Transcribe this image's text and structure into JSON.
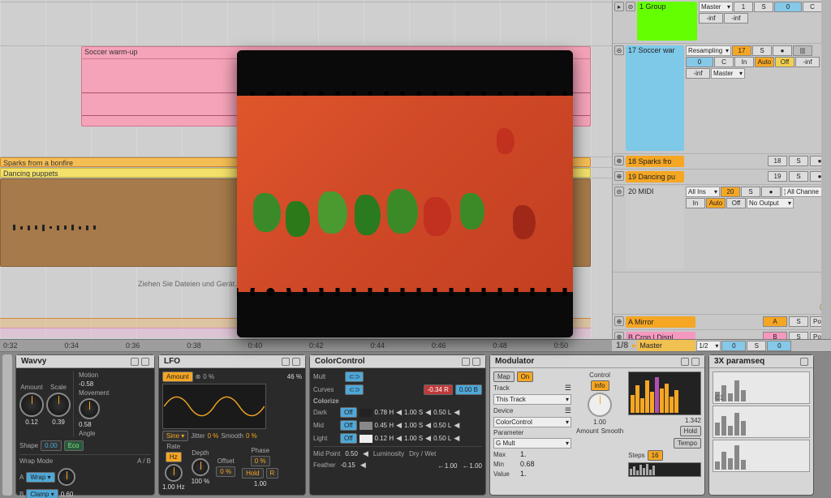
{
  "arrangement": {
    "clips": {
      "soccer": "Soccer warm-up",
      "sparks": "Sparks from a bonfire",
      "dancing": "Dancing puppets"
    },
    "drop_hint": "Ziehen Sie Dateien und Gerät…"
  },
  "ruler": [
    "0:32",
    "0:34",
    "0:36",
    "0:38",
    "0:40",
    "0:42",
    "0:44",
    "0:46",
    "0:48",
    "0:50"
  ],
  "mixer": {
    "group": {
      "label": "1 Group",
      "route": "Master",
      "num": "1",
      "s": "S",
      "send": "0",
      "c": "C",
      "inf1": "-inf",
      "inf2": "-inf"
    },
    "soccer": {
      "label": "17 Soccer war",
      "route": "Resampling",
      "num": "17",
      "s": "S",
      "rec": "●",
      "send": "0",
      "c": "C",
      "in": "In",
      "auto": "Auto",
      "off": "Off",
      "inf1": "-inf",
      "inf2": "-inf",
      "master": "Master"
    },
    "sparks": {
      "label": "18 Sparks fro",
      "num": "18",
      "s": "S",
      "rec": "●"
    },
    "dancing": {
      "label": "19 Dancing pu",
      "num": "19",
      "s": "S",
      "rec": "●"
    },
    "midi": {
      "label": "20 MIDI",
      "in_route": "All Ins",
      "ch": "¦ All Channe",
      "num": "20",
      "s": "S",
      "rec": "●",
      "in": "In",
      "auto": "Auto",
      "off": "Off",
      "out": "No Output"
    },
    "a": {
      "label": "A Mirror",
      "num": "A",
      "s": "S",
      "post": "Post"
    },
    "b": {
      "label": "B Crop | Displ",
      "num": "B",
      "s": "S",
      "post": "Post"
    },
    "master": {
      "frac": "1/8",
      "label": "Master",
      "div": "1/2",
      "send": "0",
      "s": "S",
      "val": "0"
    }
  },
  "devices": {
    "wavvy": {
      "title": "Wavvy",
      "amount": {
        "label": "Amount",
        "value": "0.12"
      },
      "scale": {
        "label": "Scale",
        "value": "0.39"
      },
      "motion": {
        "label": "Motion",
        "value": "-0.58"
      },
      "movement": {
        "label": "Movement",
        "angle_label": "Angle",
        "value": "0.58"
      },
      "shape": {
        "label": "Shape",
        "value": "0.00",
        "eco": "Eco"
      },
      "wrap": {
        "header": "Wrap Mode",
        "ab": "A / B",
        "a": {
          "lab": "A",
          "mode": "Wrap"
        },
        "b": {
          "lab": "B",
          "mode": "Clamp"
        },
        "val": "0.60"
      }
    },
    "lfo": {
      "title": "LFO",
      "amount": {
        "label": "Amount",
        "sym": "⊗",
        "pct0": "0 %",
        "pct": "46 %"
      },
      "wave": "Sine",
      "jitter": {
        "label": "Jitter",
        "val": "0 %"
      },
      "smooth": {
        "label": "Smooth",
        "val": "0 %"
      },
      "rate": {
        "label": "Rate",
        "hz_btn": "Hz",
        "value": "1.00 Hz"
      },
      "depth": {
        "label": "Depth",
        "value": "100 %"
      },
      "offset": {
        "label": "Offset",
        "value": "0 %"
      },
      "phase": {
        "label": "Phase",
        "hold": "Hold",
        "r": "R",
        "value": "1.00"
      }
    },
    "colorcontrol": {
      "title": "ColorControl",
      "mult": "Mult",
      "curves": "Curves",
      "curves_r": "-0.34 R",
      "curves_b": "0.00 B",
      "colorize": "Colorize",
      "dark": {
        "label": "Dark",
        "off": "Off",
        "h": "0.78 H",
        "s": "1.00 S",
        "l": "0.50 L"
      },
      "mid": {
        "label": "Mid",
        "off": "Off",
        "h": "0.45 H",
        "s": "1.00 S",
        "l": "0.50 L"
      },
      "light": {
        "label": "Light",
        "off": "Off",
        "h": "0.12 H",
        "s": "1.00 S",
        "l": "0.50 L"
      },
      "midpoint": {
        "label": "Mid Point",
        "value": "0.50"
      },
      "feather": {
        "label": "Feather",
        "value": "-0.15"
      },
      "lum": {
        "label": "Luminosity",
        "value": "1.00"
      },
      "drywet": {
        "label": "Dry / Wet",
        "value": "1.00"
      }
    },
    "modulator": {
      "title": "Modulator",
      "map": "Map",
      "on": "On",
      "track": "Track",
      "track_sel": "This Track",
      "device": "Device",
      "device_sel": "ColorControl",
      "param": "Parameter",
      "param_sel": "G Mult",
      "max": {
        "label": "Max",
        "value": "1."
      },
      "min": {
        "label": "Min",
        "value": "0.68"
      },
      "val": {
        "label": "Value",
        "value": "1."
      },
      "control": {
        "label": "Control",
        "info": "info",
        "value": "1.00"
      },
      "amount": {
        "label": "Amount",
        "smooth": "Smooth"
      },
      "readout": "1.342",
      "hold": "Hold",
      "tempo": "Tempo",
      "steps": {
        "label": "Steps",
        "value": "16"
      }
    },
    "paramseq": {
      "title": "3X paramseq",
      "c1": "C1"
    }
  }
}
